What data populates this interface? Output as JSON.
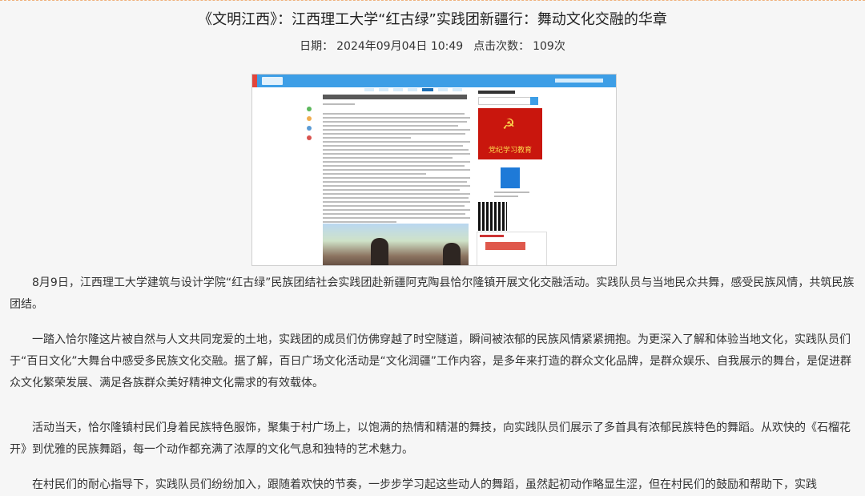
{
  "article": {
    "title": "《文明江西》：江西理工大学“红古绿”实践团新疆行：舞动文化交融的华章",
    "date_label": "日期：",
    "date": "2024年09月04日 10:49",
    "clicks_label": "点击次数：",
    "clicks": "109次",
    "paragraphs": [
      "8月9日，江西理工大学建筑与设计学院“红古绿”民族团结社会实践团赴新疆阿克陶县恰尔隆镇开展文化交融活动。实践队员与当地民众共舞，感受民族风情，共筑民族团结。",
      "一踏入恰尔隆这片被自然与人文共同宠爱的土地，实践团的成员们仿佛穿越了时空隧道，瞬间被浓郁的民族风情紧紧拥抱。为更深入了解和体验当地文化，实践队员们于“百日文化”大舞台中感受多民族文化交融。据了解，百日广场文化活动是“文化润疆”工作内容，是多年来打造的群众文化品牌，是群众娱乐、自我展示的舞台，是促进群众文化繁荣发展、满足各族群众美好精神文化需求的有效载体。",
      "活动当天，恰尔隆镇村民们身着民族特色服饰，聚集于村广场上，以饱满的热情和精湛的舞技，向实践队员们展示了多首具有浓郁民族特色的舞蹈。从欢快的《石榴花开》到优雅的民族舞蹈，每一个动作都充满了浓厚的文化气息和独特的艺术魅力。",
      "在村民们的耐心指导下，实践队员们纷纷加入，跟随着欢快的节奏，一步步学习起这些动人的舞蹈，虽然起初动作略显生涩，但在村民们的鼓励和帮助下，实践"
    ]
  },
  "screenshot": {
    "poster_text": "党纪学习教育"
  },
  "colors": {
    "accent_blue": "#3d9ee6",
    "poster_red": "#c9160d"
  }
}
